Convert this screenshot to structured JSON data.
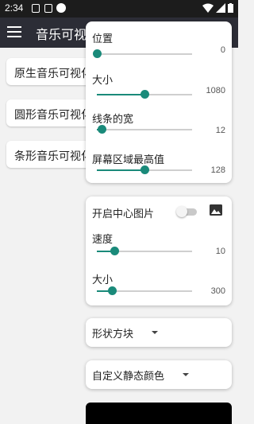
{
  "status": {
    "time": "2:34"
  },
  "appbar": {
    "title": "音乐可视化"
  },
  "background_items": [
    {
      "label": "原生音乐可视化"
    },
    {
      "label": "圆形音乐可视化"
    },
    {
      "label": "条形音乐可视化"
    }
  ],
  "position_popup": {
    "sliders": [
      {
        "label": "位置",
        "value": "0",
        "fraction": 0.0
      },
      {
        "label": "大小",
        "value": "1080",
        "fraction": 0.5
      },
      {
        "label": "线条的宽",
        "value": "12",
        "fraction": 0.05
      },
      {
        "label": "屏幕区域最高值",
        "value": "128",
        "fraction": 0.5
      }
    ]
  },
  "center_image_card": {
    "toggle_label": "开启中心图片",
    "toggle_on": false,
    "sliders": [
      {
        "label": "速度",
        "value": "10",
        "fraction": 0.18
      },
      {
        "label": "大小",
        "value": "300",
        "fraction": 0.16
      }
    ]
  },
  "shape_dropdown": {
    "label": "形状方块"
  },
  "color_dropdown": {
    "label": "自定义静态颜色"
  },
  "colors": {
    "accent": "#1a8a7a",
    "appbar": "#2c2d36",
    "statusbar": "#1c1c1c"
  },
  "icons": [
    "menu-icon",
    "image-icon",
    "wifi-icon",
    "signal-icon",
    "battery-icon"
  ]
}
